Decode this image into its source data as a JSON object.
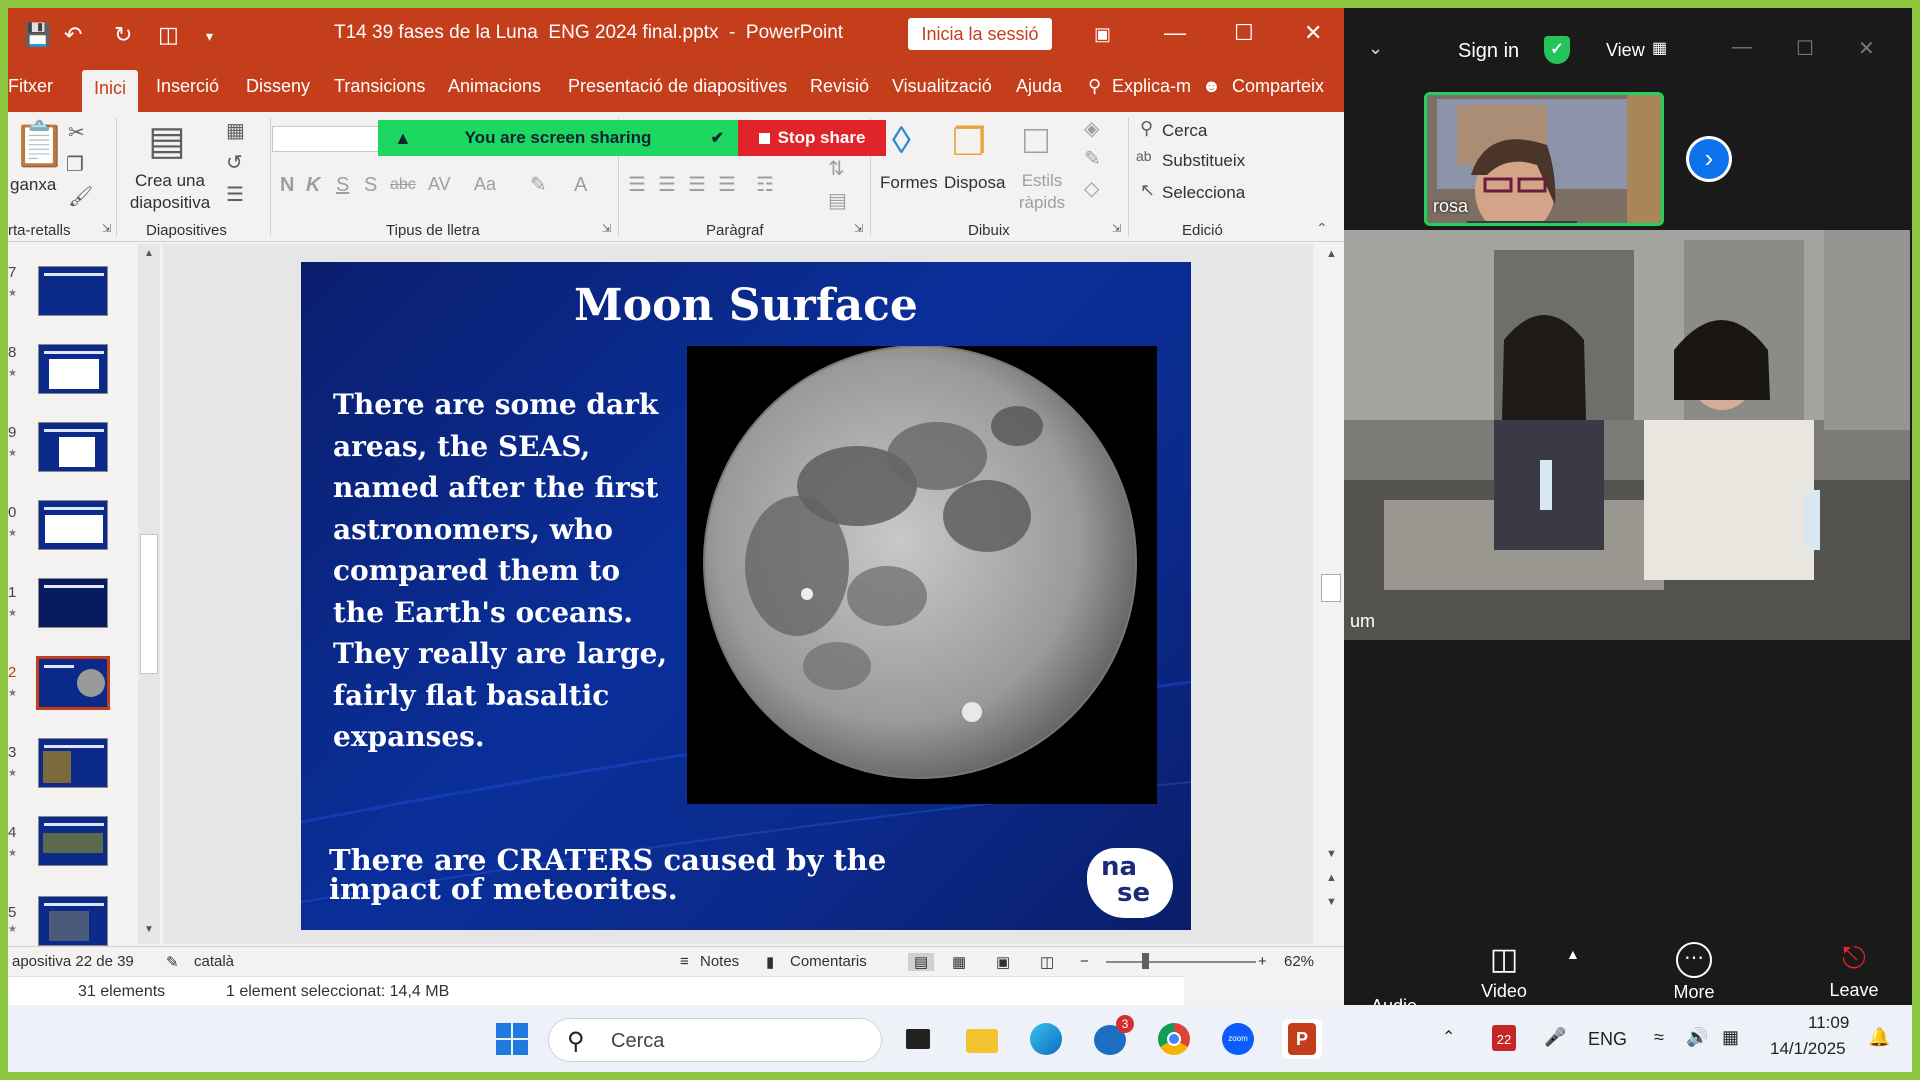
{
  "ppt": {
    "window_title": "T14 39 fases de la Luna  ENG 2024 final.pptx  -  PowerPoint",
    "signin_button": "Inicia la sessió",
    "tabs": [
      "Fitxer",
      "Inici",
      "Inserció",
      "Disseny",
      "Transicions",
      "Animacions",
      "Presentació de diapositives",
      "Revisió",
      "Visualització",
      "Ajuda",
      "Explica-m",
      "Comparteix"
    ],
    "ribbon": {
      "paste_label": "ganxa",
      "new_slide_label": "Crea una diapositiva",
      "draw_shapes": "Formes",
      "draw_arrange": "Disposa",
      "draw_styles": "Estils ràpids",
      "find": "Cerca",
      "replace": "Substitueix",
      "select": "Selecciona",
      "group_clipboard": "rta-retalls",
      "group_slides": "Diapositives",
      "group_font": "Tipus de lletra",
      "group_paragraph": "Paràgraf",
      "group_drawing": "Dibuix",
      "group_editing": "Edició",
      "font_buttons": [
        "N",
        "K",
        "S",
        "S",
        "abc",
        "AV",
        "Aa",
        "A"
      ]
    },
    "share_bar": {
      "status": "You are screen sharing",
      "stop": "Stop share"
    },
    "thumbnails": {
      "numbers": [
        "7",
        "8",
        "9",
        "0",
        "1",
        "2",
        "3",
        "4",
        "5"
      ],
      "selected_index": 5
    },
    "slide": {
      "title": "Moon Surface",
      "body": "There are some dark areas, the SEAS, named after the first astronomers, who compared them to the Earth's oceans. They really are large, fairly flat basaltic expanses.",
      "footer": "There are CRATERS caused by the impact of meteorites.",
      "logo_text": "nase"
    },
    "status": {
      "slide_counter": "apositiva 22 de 39",
      "language": "català",
      "notes": "Notes",
      "comments": "Comentaris",
      "zoom": "62%"
    },
    "explorer": {
      "count": "31 elements",
      "selection": "1 element seleccionat: 14,4 MB"
    }
  },
  "zoom": {
    "signin": "Sign in",
    "view": "View",
    "speaker_name": "rosa",
    "room_name": "um",
    "controls": {
      "audio": "Audio",
      "video": "Video",
      "more": "More",
      "leave": "Leave"
    }
  },
  "taskbar": {
    "search_placeholder": "Cerca",
    "lang": "ENG",
    "time": "11:09",
    "date": "14/1/2025",
    "calendar_day": "22",
    "mail_badge": "3"
  },
  "colors": {
    "ppt_accent": "#c43e1c",
    "share_green": "#1cd760",
    "share_red": "#e0242a",
    "zoom_blue": "#0e72ed",
    "slide_blue": "#0a2f9a",
    "frame_green": "#8cc63f"
  }
}
